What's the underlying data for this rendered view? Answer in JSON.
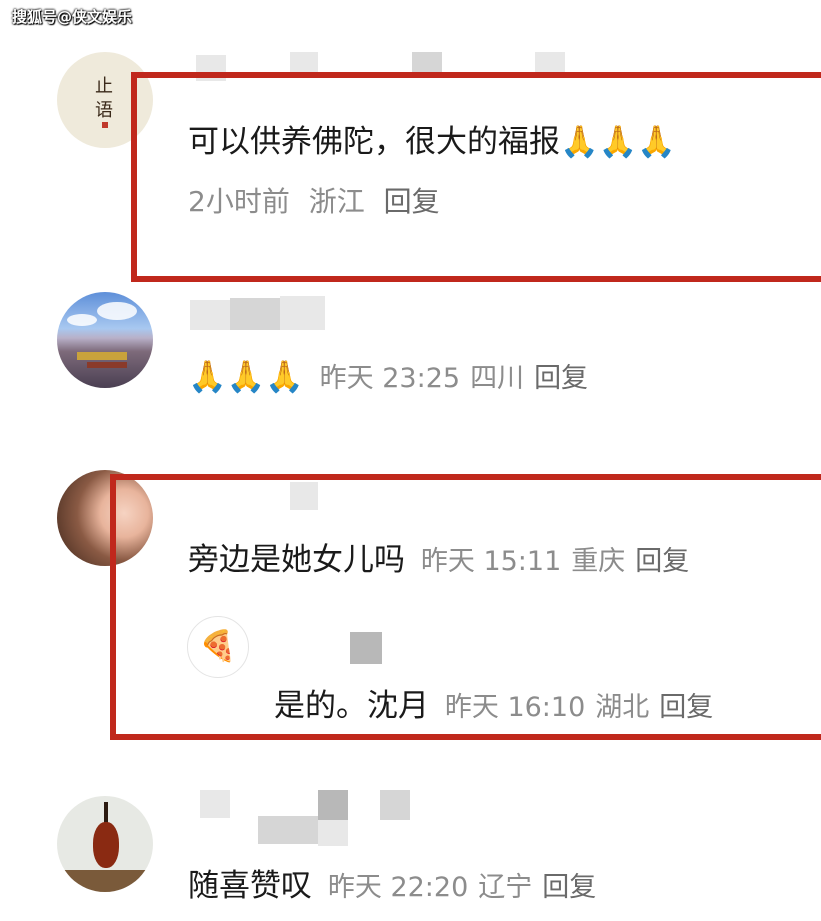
{
  "watermark": "搜狐号@侠文娱乐",
  "comments": [
    {
      "avatar": "seal-avatar",
      "avatar_text": [
        "止",
        "语"
      ],
      "text": "可以供养佛陀，很大的福报🙏🙏🙏",
      "time": "2小时前",
      "location": "浙江",
      "reply": "回复"
    },
    {
      "avatar": "landscape-avatar",
      "text": "🙏🙏🙏",
      "time": "昨天 23:25",
      "location": "四川",
      "reply": "回复"
    },
    {
      "avatar": "portrait-avatar",
      "text": "旁边是她女儿吗",
      "time": "昨天 15:11",
      "location": "重庆",
      "reply": "回复",
      "sub_reply": {
        "avatar": "pizza-avatar",
        "text": "是的。沈月",
        "time": "昨天 16:10",
        "location": "湖北",
        "reply": "回复"
      }
    },
    {
      "avatar": "violin-avatar",
      "text": "随喜赞叹",
      "time": "昨天 22:20",
      "location": "辽宁",
      "reply": "回复"
    }
  ],
  "colors": {
    "highlight": "#c0281c",
    "meta": "#8c8c8c",
    "text": "#1a1a1a"
  }
}
